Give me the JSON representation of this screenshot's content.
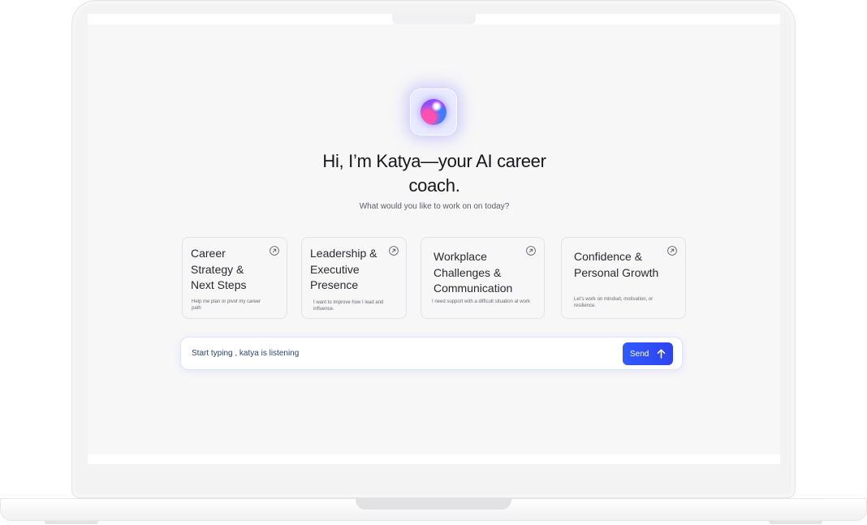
{
  "assistant": {
    "heading": "Hi, I’m Katya—your AI career coach.",
    "subheading": "What would you like to work on on today?"
  },
  "cards": [
    {
      "title": "Career Strategy & Next Steps",
      "description": "Help me plan or pivot my career path"
    },
    {
      "title": "Leadership & Executive Presence",
      "description": "I want to improve how I lead and influence."
    },
    {
      "title": "Workplace Challenges & Communication",
      "description": "I need support with a difficult situation at work"
    },
    {
      "title": "Confidence & Personal Growth",
      "description": "Let’s work on mindset, motivation, or resilience."
    }
  ],
  "chat": {
    "placeholder": "Start typing , katya is listening",
    "send_label": "Send"
  },
  "icons": {
    "card_arrow": "arrow-up-right-circle-icon",
    "send": "arrow-up-icon",
    "assistant": "ai-orb-icon"
  },
  "colors": {
    "accent": "#2f4cf5",
    "orb_glow": "#7c6cff"
  }
}
